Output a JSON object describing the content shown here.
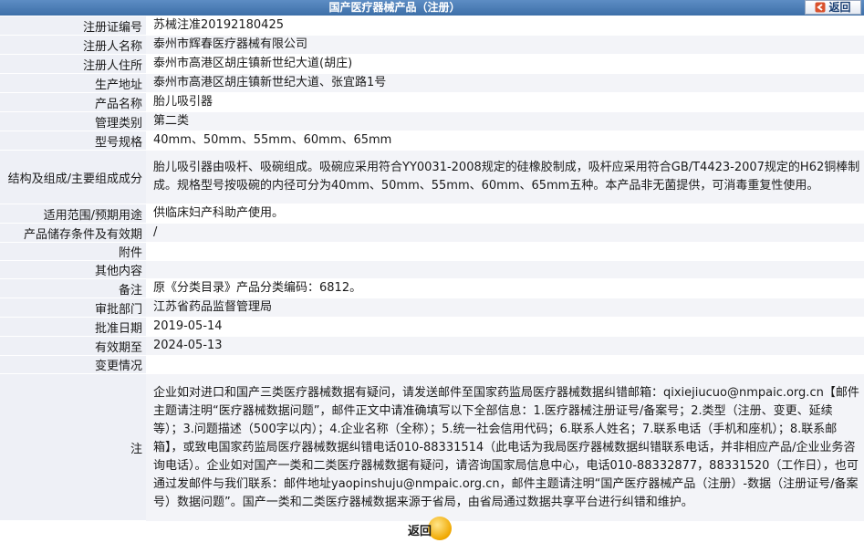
{
  "header": {
    "title": "国产医疗器械产品（注册）",
    "back_label": "返回"
  },
  "rows": [
    {
      "label": "注册证编号",
      "value": "苏械注准20192180425"
    },
    {
      "label": "注册人名称",
      "value": "泰州市辉春医疗器械有限公司"
    },
    {
      "label": "注册人住所",
      "value": "泰州市高港区胡庄镇新世纪大道(胡庄)"
    },
    {
      "label": "生产地址",
      "value": "泰州市高港区胡庄镇新世纪大道、张宜路1号"
    },
    {
      "label": "产品名称",
      "value": "胎儿吸引器"
    },
    {
      "label": "管理类别",
      "value": "第二类"
    },
    {
      "label": "型号规格",
      "value": "40mm、50mm、55mm、60mm、65mm"
    },
    {
      "label": "结构及组成/主要组成成分",
      "value": "胎儿吸引器由吸杆、吸碗组成。吸碗应采用符合YY0031-2008规定的硅橡胶制成，吸杆应采用符合GB/T4423-2007规定的H62铜棒制成。规格型号按吸碗的内径可分为40mm、50mm、55mm、60mm、65mm五种。本产品非无菌提供，可消毒重复性使用。"
    },
    {
      "label": "适用范围/预期用途",
      "value": "供临床妇产科助产使用。"
    },
    {
      "label": "产品储存条件及有效期",
      "value": "/"
    },
    {
      "label": "附件",
      "value": ""
    },
    {
      "label": "其他内容",
      "value": ""
    },
    {
      "label": "备注",
      "value": "原《分类目录》产品分类编码：6812。"
    },
    {
      "label": "审批部门",
      "value": "江苏省药品监督管理局"
    },
    {
      "label": "批准日期",
      "value": "2019-05-14"
    },
    {
      "label": "有效期至",
      "value": "2024-05-13"
    },
    {
      "label": "变更情况",
      "value": ""
    }
  ],
  "note": {
    "label": "注",
    "value": "企业如对进口和国产三类医疗器械数据有疑问，请发送邮件至国家药监局医疗器械数据纠错邮箱：qixiejiucuo@nmpaic.org.cn【邮件主题请注明“医疗器械数据问题”，邮件正文中请准确填写以下全部信息：1.医疗器械注册证号/备案号；2.类型（注册、变更、延续等）；3.问题描述（500字以内）；4.企业名称（全称）；5.统一社会信用代码；6.联系人姓名；7.联系电话（手机和座机）；8.联系邮箱】，或致电国家药监局医疗器械数据纠错电话010-88331514（此电话为我局医疗器械数据纠错联系电话，并非相应产品/企业业务咨询电话）。企业如对国产一类和二类医疗器械数据有疑问，请咨询国家局信息中心，电话010-88332877，88331520（工作日），也可通过发邮件与我们联系：邮件地址yaopinshuju@nmpaic.org.cn，邮件主题请注明“国产医疗器械产品（注册）-数据（注册证号/备案号）数据问题”。国产一类和二类医疗器械数据来源于省局，由省局通过数据共享平台进行纠错和维护。"
  },
  "footer": {
    "back_label": "返回"
  },
  "colors": {
    "header_bg": "#3d6fa8",
    "label_bg": "#eef0f6",
    "back_button_circle": "#f0a800"
  }
}
